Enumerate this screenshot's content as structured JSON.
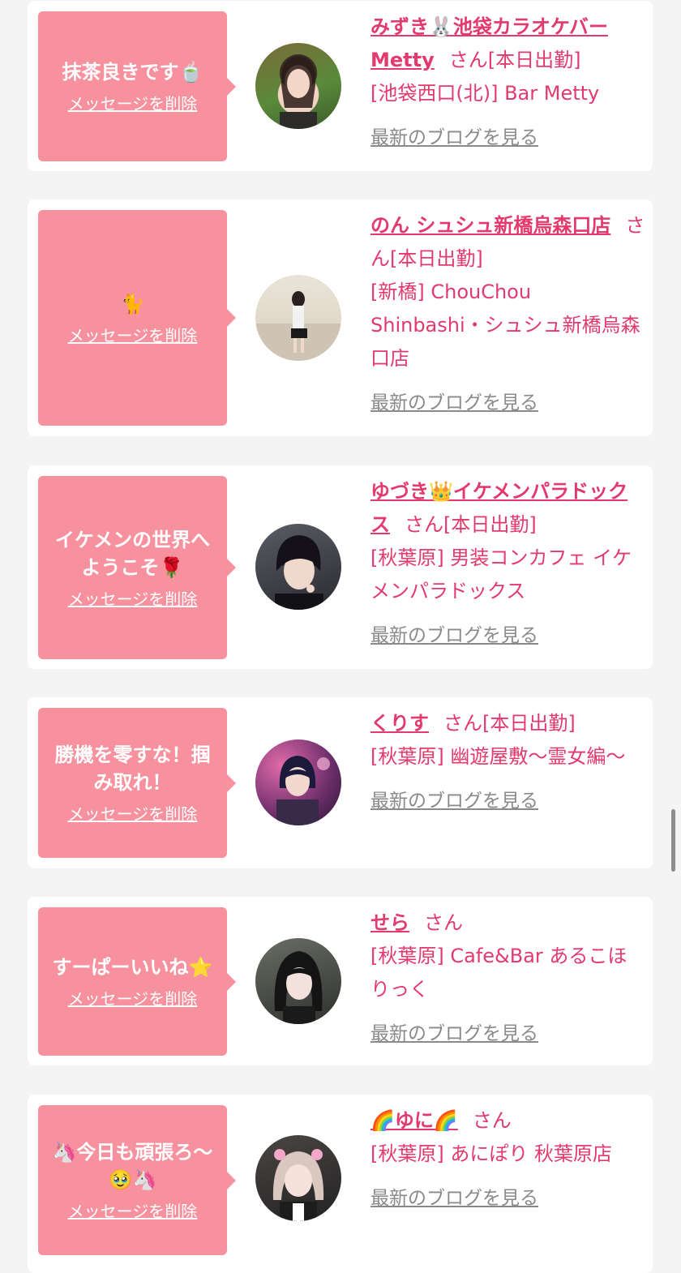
{
  "theme": {
    "bubble_color": "#f7919e",
    "name_color": "#e23a6e",
    "link_gray": "#8a8a8a"
  },
  "cards": [
    {
      "message": "抹茶良きです🍵",
      "delete_label": "メッセージを削除",
      "name": "みずき🐰池袋カラオケバーMetty",
      "san": "さん",
      "status": "[本日出勤]",
      "shop": "[池袋西口(北)] Bar Metty",
      "blog_label": "最新のブログを見る"
    },
    {
      "message": "🐈",
      "delete_label": "メッセージを削除",
      "name": "のん シュシュ新橋烏森口店",
      "san": "さん",
      "status": "[本日出勤]",
      "shop": "[新橋] ChouChou Shinbashi・シュシュ新橋烏森口店",
      "blog_label": "最新のブログを見る"
    },
    {
      "message": "イケメンの世界へようこそ🌹",
      "delete_label": "メッセージを削除",
      "name": "ゆづき👑イケメンパラドックス",
      "san": "さん",
      "status": "[本日出勤]",
      "shop": "[秋葉原] 男装コンカフェ イケメンパラドックス",
      "blog_label": "最新のブログを見る"
    },
    {
      "message": "勝機を零すな！掴み取れ！",
      "delete_label": "メッセージを削除",
      "name": "くりす",
      "san": "さん",
      "status": "[本日出勤]",
      "shop": "[秋葉原] 幽遊屋敷〜霊女編〜",
      "blog_label": "最新のブログを見る"
    },
    {
      "message": "すーぱーいいね⭐",
      "delete_label": "メッセージを削除",
      "name": "せら",
      "san": "さん",
      "status": "",
      "shop": "[秋葉原] Cafe&Bar あるこほりっく",
      "blog_label": "最新のブログを見る"
    },
    {
      "message": "🦄今日も頑張ろ〜🥹🦄",
      "delete_label": "メッセージを削除",
      "name": "🌈ゆに🌈",
      "san": "さん",
      "status": "",
      "shop": "[秋葉原] あにぽり 秋葉原店",
      "blog_label": "最新のブログを見る"
    }
  ]
}
